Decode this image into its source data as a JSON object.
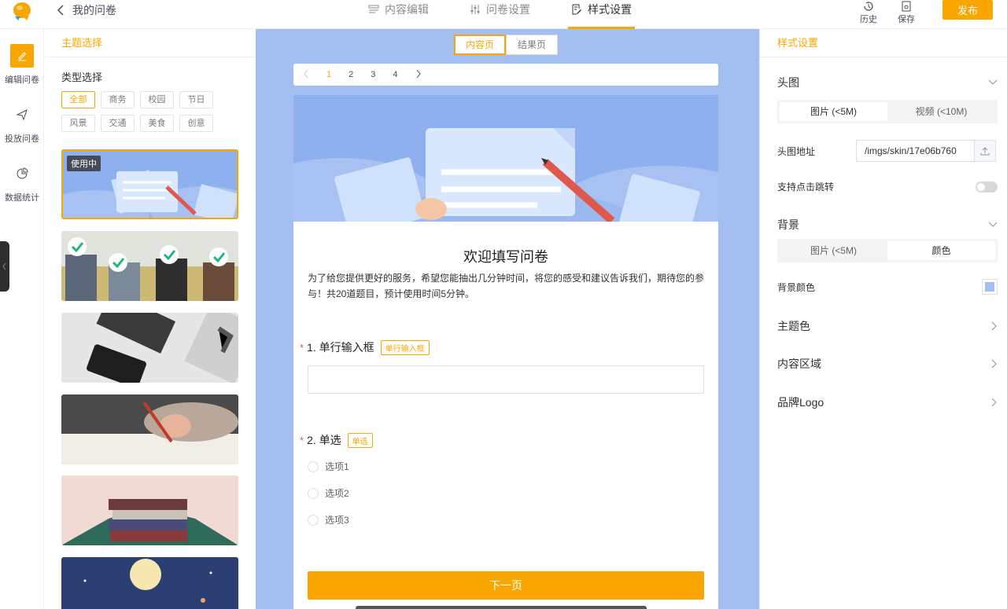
{
  "header": {
    "back_label": "我的问卷",
    "tabs": [
      {
        "label": "内容编辑",
        "icon": "list-icon",
        "active": false
      },
      {
        "label": "问卷设置",
        "icon": "sliders-icon",
        "active": false
      },
      {
        "label": "样式设置",
        "icon": "edit-doc-icon",
        "active": true
      }
    ],
    "history_label": "历史",
    "save_label": "保存",
    "publish_label": "发布"
  },
  "nav": {
    "items": [
      {
        "label": "编辑问卷",
        "icon": "pencil-icon",
        "active": true
      },
      {
        "label": "投放问卷",
        "icon": "send-icon",
        "active": false
      },
      {
        "label": "数据统计",
        "icon": "pie-chart-icon",
        "active": false
      }
    ]
  },
  "left_panel": {
    "title": "主题选择",
    "type_label": "类型选择",
    "categories": [
      "全部",
      "商务",
      "校园",
      "节日",
      "风景",
      "交通",
      "美食",
      "创意"
    ],
    "active_category": "全部",
    "in_use_badge": "使用中"
  },
  "center": {
    "page_tabs": [
      "内容页",
      "结果页"
    ],
    "active_page_tab": "内容页",
    "pages": [
      "1",
      "2",
      "3",
      "4"
    ],
    "current_page": "1",
    "form": {
      "title": "欢迎填写问卷",
      "description": "为了给您提供更好的服务，希望您能抽出几分钟时间，将您的感受和建议告诉我们，期待您的参与！共20道题目，预计使用时间5分钟。",
      "q1": {
        "required": "*",
        "title": "1. 单行输入框",
        "tag": "单行输入框"
      },
      "q2": {
        "required": "*",
        "title": "2. 单选",
        "tag": "单选",
        "options": [
          "选项1",
          "选项2",
          "选项3"
        ]
      },
      "next_label": "下一页"
    }
  },
  "right_panel": {
    "title": "样式设置",
    "head_image": {
      "label": "头图",
      "segments": [
        "图片 (<5M)",
        "视频 (<10M)"
      ],
      "active": "图片 (<5M)",
      "url_label": "头图地址",
      "url_value": "/imgs/skin/17e06b760",
      "click_jump_label": "支持点击跳转",
      "click_jump_enabled": false
    },
    "background": {
      "label": "背景",
      "segments": [
        "图片 (<5M)",
        "颜色"
      ],
      "active": "颜色",
      "color_label": "背景颜色",
      "color_value": "#a3bff2"
    },
    "theme_color_label": "主题色",
    "content_area_label": "内容区域",
    "brand_logo_label": "品牌Logo"
  },
  "colors": {
    "accent": "#faa600",
    "canvas": "#a3bff2"
  }
}
